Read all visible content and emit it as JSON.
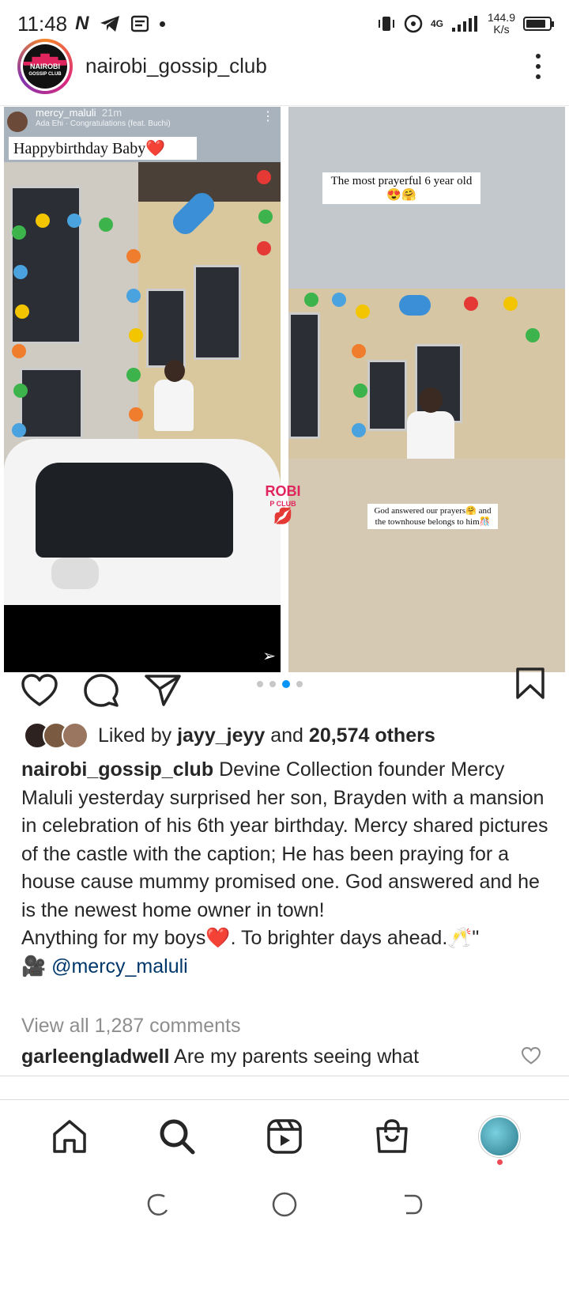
{
  "status_bar": {
    "time": "11:48",
    "network_speed_value": "144.9",
    "network_speed_unit": "K/s",
    "network_type": "4G"
  },
  "header": {
    "username": "nairobi_gossip_club",
    "avatar_logo_line1": "NAIROBI",
    "avatar_logo_line2": "GOSSIP CLUB"
  },
  "post": {
    "slide_left": {
      "story_user": "mercy_maluli",
      "story_time": "21m",
      "story_song": "Ada Ehi · Congratulations (feat. Buchi)",
      "caption": "Happybirthday Baby❤️"
    },
    "slide_right": {
      "caption_top": "The most prayerful 6 year old 😍🤗",
      "caption_bottom": "God answered our prayers🤗 and the townhouse belongs to him🎊"
    },
    "watermark": "ROBI",
    "watermark_sub": "P CLUB",
    "pagination": {
      "count": 4,
      "active_index": 2
    }
  },
  "likes": {
    "prefix": "Liked by",
    "user": "jayy_jeyy",
    "and": "and",
    "others": "20,574 others"
  },
  "caption": {
    "username": "nairobi_gossip_club",
    "text": "Devine Collection founder Mercy Maluli yesterday surprised her son, Brayden with a mansion in celebration of his 6th year birthday. Mercy shared pictures of the castle with the caption; He has been praying for a house cause mummy promised one. God answered and he is the newest home owner in town!",
    "line2": "Anything for my boys❤️. To brighter days ahead.🥂\"",
    "credit_emoji": "🎥",
    "credit_mention": "@mercy_maluli"
  },
  "comments": {
    "view_all": "View all 1,287 comments",
    "first_user": "garleengladwell",
    "first_text": "Are my parents seeing what"
  },
  "colors": {
    "accent_blue": "#0095f6",
    "mention_blue": "#00376b",
    "heart_red": "#ed4956",
    "muted_gray": "#8e8e8e"
  },
  "icons": {
    "like": "heart-icon",
    "comment": "comment-icon",
    "share": "send-icon",
    "save": "bookmark-icon",
    "home": "home-icon",
    "search": "search-icon",
    "reels": "reels-icon",
    "shop": "shop-icon"
  }
}
